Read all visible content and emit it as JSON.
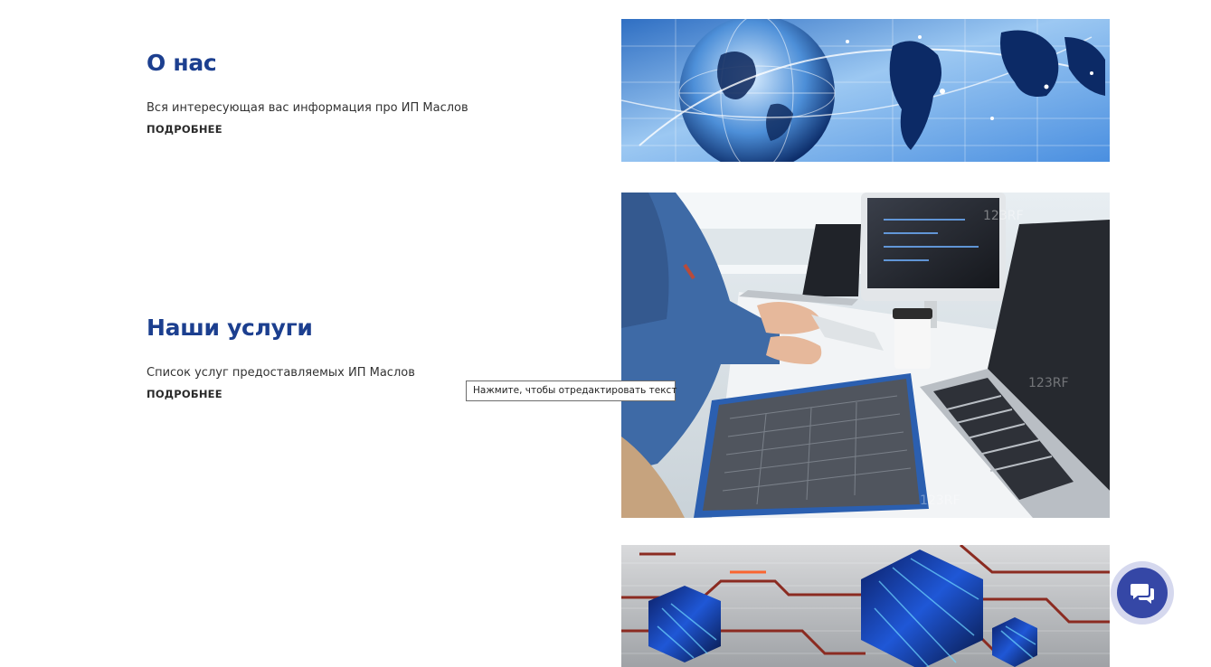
{
  "sections": [
    {
      "title": "О нас",
      "description": "Вся интересующая вас информация про ИП Маслов",
      "more_label": "ПОДРОБНЕЕ",
      "image": "globe-network-image"
    },
    {
      "title": "Наши услуги",
      "description": "Список услуг предоставляемых ИП Маслов",
      "more_label": "ПОДРОБНЕЕ",
      "image": "developer-laptops-image"
    },
    {
      "image": "hexagon-circuit-image"
    }
  ],
  "tooltip": {
    "text": "Нажмите, чтобы отредактировать текст"
  },
  "chat_widget": {
    "icon": "chat-bubbles-icon"
  },
  "colors": {
    "title": "#1c3f8f",
    "chat_button": "#3547a6",
    "chat_ring": "#d5d8ee"
  }
}
